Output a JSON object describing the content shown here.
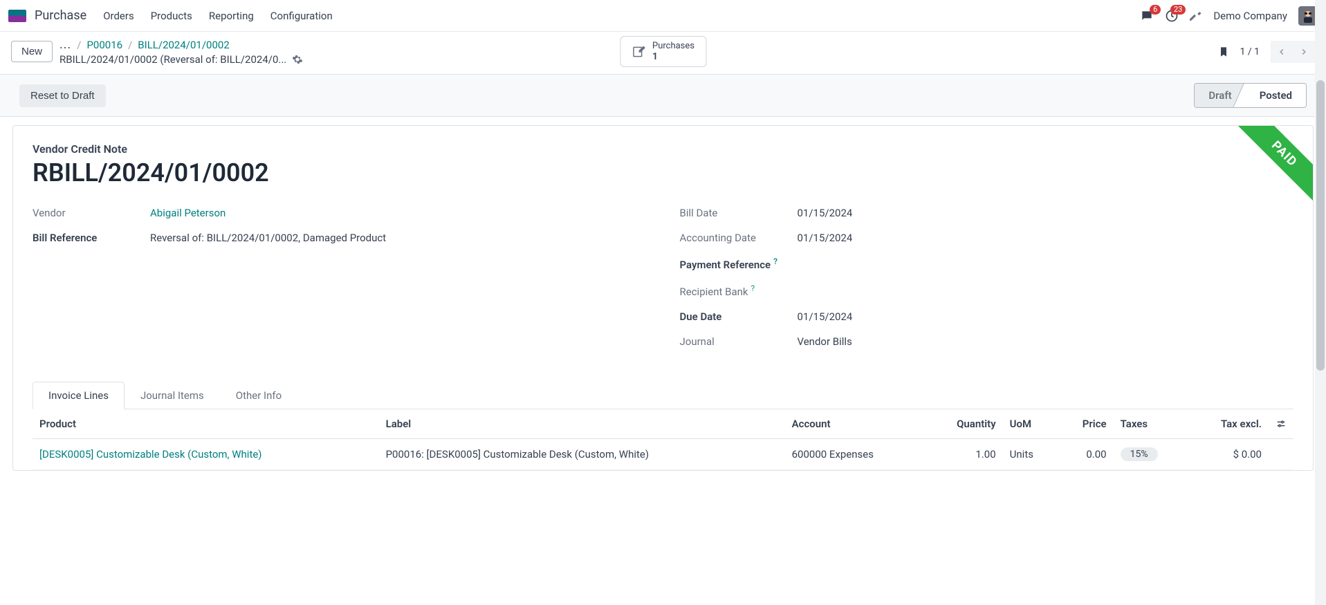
{
  "nav": {
    "app": "Purchase",
    "links": [
      "Orders",
      "Products",
      "Reporting",
      "Configuration"
    ],
    "messages_badge": "6",
    "activities_badge": "23",
    "company": "Demo Company"
  },
  "control": {
    "new_label": "New",
    "breadcrumb_a": "P00016",
    "breadcrumb_b": "BILL/2024/01/0002",
    "subtitle": "RBILL/2024/01/0002 (Reversal of: BILL/2024/0...",
    "stat_label": "Purchases",
    "stat_value": "1",
    "pager": "1 / 1"
  },
  "status": {
    "reset_label": "Reset to Draft",
    "draft": "Draft",
    "posted": "Posted"
  },
  "doc": {
    "type": "Vendor Credit Note",
    "number": "RBILL/2024/01/0002",
    "ribbon": "PAID",
    "left": {
      "vendor_label": "Vendor",
      "vendor_value": "Abigail Peterson",
      "billref_label": "Bill Reference",
      "billref_value": "Reversal of: BILL/2024/01/0002, Damaged Product"
    },
    "right": {
      "billdate_label": "Bill Date",
      "billdate_value": "01/15/2024",
      "acctdate_label": "Accounting Date",
      "acctdate_value": "01/15/2024",
      "payref_label": "Payment Reference",
      "recbank_label": "Recipient Bank",
      "duedate_label": "Due Date",
      "duedate_value": "01/15/2024",
      "journal_label": "Journal",
      "journal_value": "Vendor Bills"
    }
  },
  "tabs": {
    "t1": "Invoice Lines",
    "t2": "Journal Items",
    "t3": "Other Info"
  },
  "table": {
    "headers": {
      "product": "Product",
      "label": "Label",
      "account": "Account",
      "quantity": "Quantity",
      "uom": "UoM",
      "price": "Price",
      "taxes": "Taxes",
      "taxexcl": "Tax excl."
    },
    "rows": [
      {
        "product": "[DESK0005] Customizable Desk (Custom, White)",
        "label": "P00016: [DESK0005] Customizable Desk (Custom, White)",
        "account": "600000 Expenses",
        "quantity": "1.00",
        "uom": "Units",
        "price": "0.00",
        "taxes": "15%",
        "taxexcl": "$ 0.00"
      }
    ]
  }
}
